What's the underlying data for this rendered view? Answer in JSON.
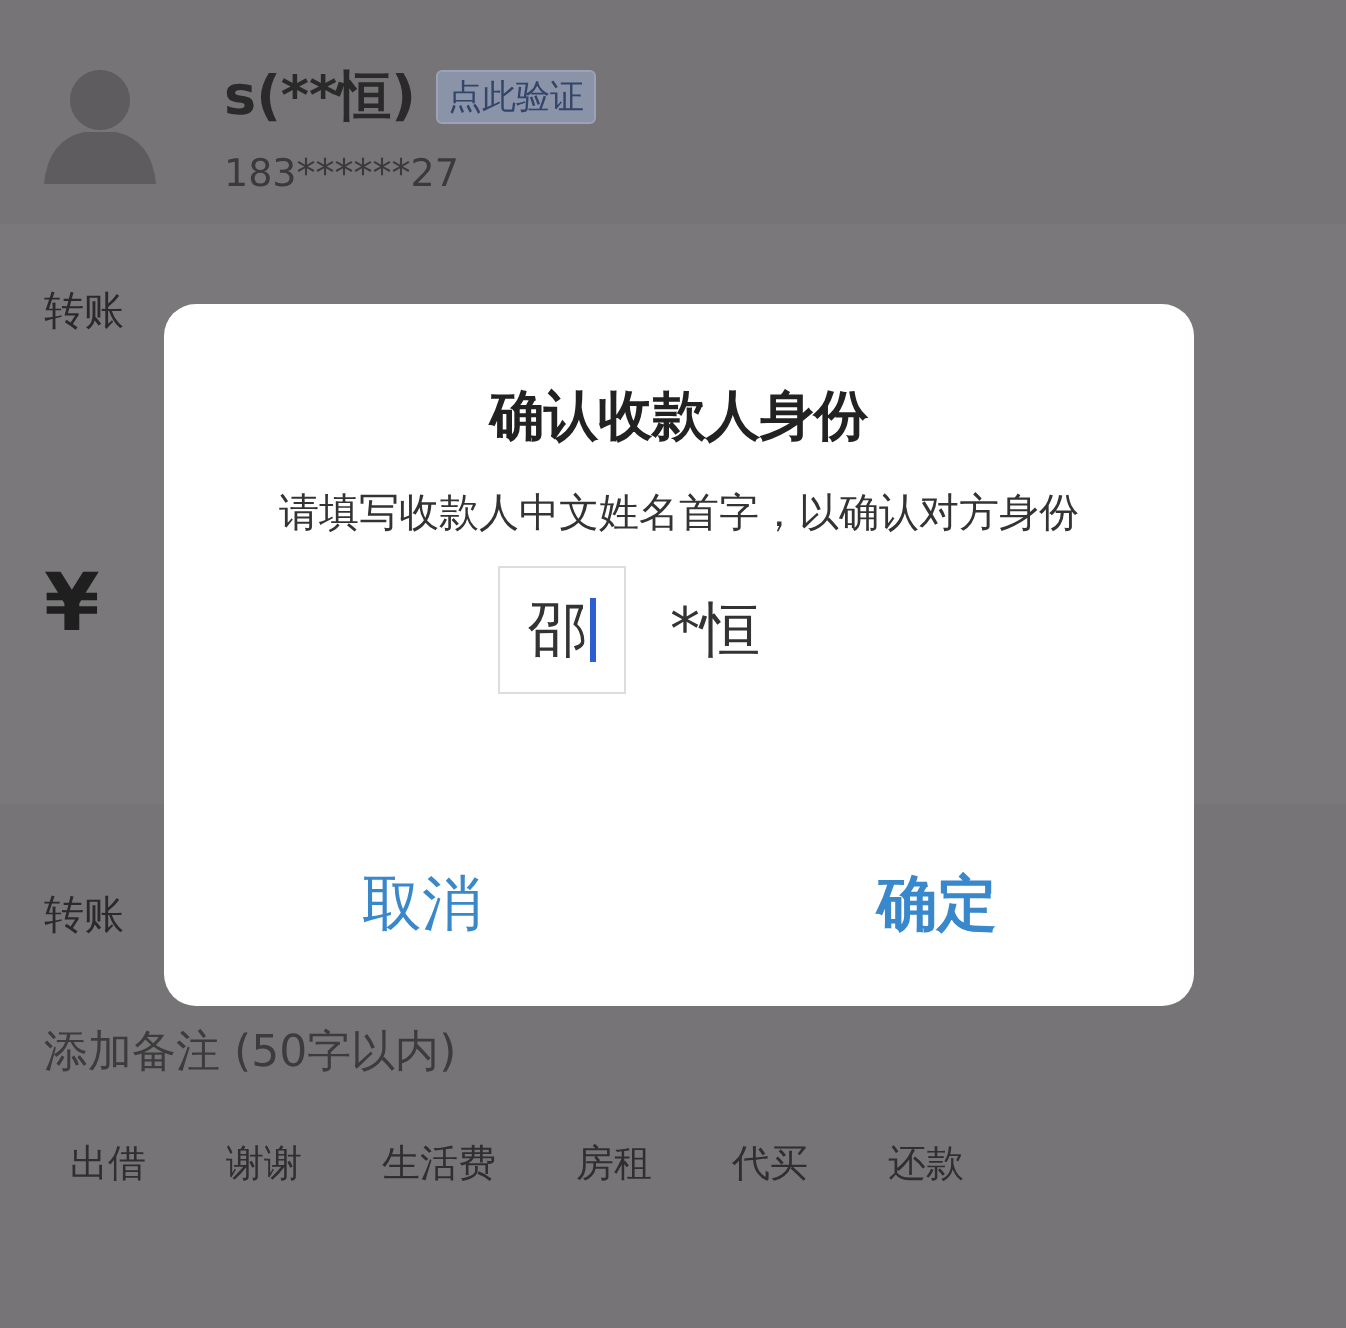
{
  "payee": {
    "name": "s(**恒)",
    "verify_badge": "点此验证",
    "phone": "183******27"
  },
  "amount_card": {
    "label": "转账",
    "currency": "¥"
  },
  "remark": {
    "label": "转账",
    "placeholder": "添加备注 (50字以内)",
    "chips": [
      "出借",
      "谢谢",
      "生活费",
      "房租",
      "代买",
      "还款"
    ]
  },
  "dialog": {
    "title": "确认收款人身份",
    "message": "请填写收款人中文姓名首字，以确认对方身份",
    "input_value": "邵",
    "masked_rest": "*恒",
    "buttons": [
      {
        "label": "取消",
        "kind": "cancel"
      },
      {
        "label": "确定",
        "kind": "confirm"
      }
    ]
  }
}
